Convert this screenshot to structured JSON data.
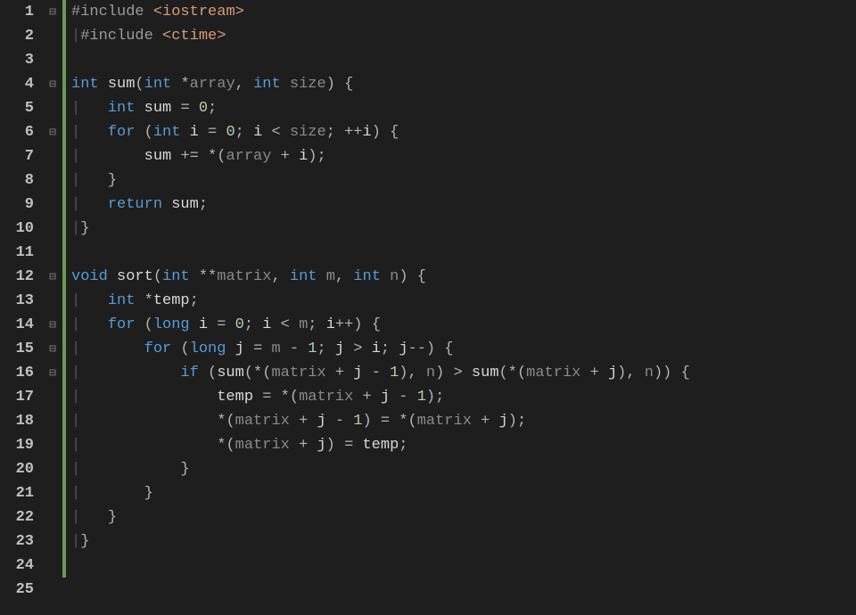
{
  "editor": {
    "line_count": 25,
    "fold_markers": {
      "1": "⊟",
      "4": "⊟",
      "6": "⊟",
      "12": "⊟",
      "14": "⊟",
      "15": "⊟",
      "16": "⊟"
    },
    "changed_lines": [
      1,
      2,
      3,
      4,
      5,
      6,
      7,
      8,
      9,
      10,
      11,
      12,
      13,
      14,
      15,
      16,
      17,
      18,
      19,
      20,
      21,
      22,
      23,
      24
    ],
    "code_lines": [
      {
        "n": 1,
        "tokens": [
          [
            "pp",
            "#include "
          ],
          [
            "inc",
            "<iostream>"
          ]
        ]
      },
      {
        "n": 2,
        "tokens": [
          [
            "vbar",
            "|"
          ],
          [
            "pp",
            "#include "
          ],
          [
            "inc",
            "<ctime>"
          ]
        ]
      },
      {
        "n": 3,
        "tokens": []
      },
      {
        "n": 4,
        "tokens": [
          [
            "kw",
            "int"
          ],
          [
            "id",
            " "
          ],
          [
            "fn",
            "sum"
          ],
          [
            "par",
            "("
          ],
          [
            "kw",
            "int"
          ],
          [
            "id",
            " "
          ],
          [
            "op",
            "*"
          ],
          [
            "g",
            "array"
          ],
          [
            "op",
            ", "
          ],
          [
            "kw",
            "int"
          ],
          [
            "id",
            " "
          ],
          [
            "g",
            "size"
          ],
          [
            "par",
            ") "
          ],
          [
            "par",
            "{"
          ]
        ]
      },
      {
        "n": 5,
        "tokens": [
          [
            "vbar",
            "|   "
          ],
          [
            "kw",
            "int"
          ],
          [
            "id",
            " sum "
          ],
          [
            "op",
            "= "
          ],
          [
            "num",
            "0"
          ],
          [
            "op",
            ";"
          ]
        ]
      },
      {
        "n": 6,
        "tokens": [
          [
            "vbar",
            "|   "
          ],
          [
            "kw",
            "for"
          ],
          [
            "id",
            " "
          ],
          [
            "par",
            "("
          ],
          [
            "kw",
            "int"
          ],
          [
            "id",
            " i "
          ],
          [
            "op",
            "= "
          ],
          [
            "num",
            "0"
          ],
          [
            "op",
            "; "
          ],
          [
            "id",
            "i "
          ],
          [
            "op",
            "< "
          ],
          [
            "g",
            "size"
          ],
          [
            "op",
            "; "
          ],
          [
            "op",
            "++"
          ],
          [
            "id",
            "i"
          ],
          [
            "par",
            ") "
          ],
          [
            "par",
            "{"
          ]
        ]
      },
      {
        "n": 7,
        "tokens": [
          [
            "vbar",
            "|       "
          ],
          [
            "id",
            "sum "
          ],
          [
            "op",
            "+= "
          ],
          [
            "op",
            "*"
          ],
          [
            "par",
            "("
          ],
          [
            "g",
            "array"
          ],
          [
            "id",
            " "
          ],
          [
            "op",
            "+ "
          ],
          [
            "id",
            "i"
          ],
          [
            "par",
            ")"
          ],
          [
            "op",
            ";"
          ]
        ]
      },
      {
        "n": 8,
        "tokens": [
          [
            "vbar",
            "|   "
          ],
          [
            "par",
            "}"
          ]
        ]
      },
      {
        "n": 9,
        "tokens": [
          [
            "vbar",
            "|   "
          ],
          [
            "kw",
            "return"
          ],
          [
            "id",
            " sum"
          ],
          [
            "op",
            ";"
          ]
        ]
      },
      {
        "n": 10,
        "tokens": [
          [
            "vbar",
            "|"
          ],
          [
            "par",
            "}"
          ]
        ]
      },
      {
        "n": 11,
        "tokens": []
      },
      {
        "n": 12,
        "tokens": [
          [
            "kw",
            "void"
          ],
          [
            "id",
            " "
          ],
          [
            "fn",
            "sort"
          ],
          [
            "par",
            "("
          ],
          [
            "kw",
            "int"
          ],
          [
            "id",
            " "
          ],
          [
            "op",
            "**"
          ],
          [
            "g",
            "matrix"
          ],
          [
            "op",
            ", "
          ],
          [
            "kw",
            "int"
          ],
          [
            "id",
            " "
          ],
          [
            "g",
            "m"
          ],
          [
            "op",
            ", "
          ],
          [
            "kw",
            "int"
          ],
          [
            "id",
            " "
          ],
          [
            "g",
            "n"
          ],
          [
            "par",
            ") "
          ],
          [
            "par",
            "{"
          ]
        ]
      },
      {
        "n": 13,
        "tokens": [
          [
            "vbar",
            "|   "
          ],
          [
            "kw",
            "int"
          ],
          [
            "id",
            " "
          ],
          [
            "op",
            "*"
          ],
          [
            "id",
            "temp"
          ],
          [
            "op",
            ";"
          ]
        ]
      },
      {
        "n": 14,
        "tokens": [
          [
            "vbar",
            "|   "
          ],
          [
            "kw",
            "for"
          ],
          [
            "id",
            " "
          ],
          [
            "par",
            "("
          ],
          [
            "kw",
            "long"
          ],
          [
            "id",
            " i "
          ],
          [
            "op",
            "= "
          ],
          [
            "num",
            "0"
          ],
          [
            "op",
            "; "
          ],
          [
            "id",
            "i "
          ],
          [
            "op",
            "< "
          ],
          [
            "g",
            "m"
          ],
          [
            "op",
            "; "
          ],
          [
            "id",
            "i"
          ],
          [
            "op",
            "++"
          ],
          [
            "par",
            ") "
          ],
          [
            "par",
            "{"
          ]
        ]
      },
      {
        "n": 15,
        "tokens": [
          [
            "vbar",
            "|       "
          ],
          [
            "kw",
            "for"
          ],
          [
            "id",
            " "
          ],
          [
            "par",
            "("
          ],
          [
            "kw",
            "long"
          ],
          [
            "id",
            " j "
          ],
          [
            "op",
            "= "
          ],
          [
            "g",
            "m"
          ],
          [
            "id",
            " "
          ],
          [
            "op",
            "- "
          ],
          [
            "num",
            "1"
          ],
          [
            "op",
            "; "
          ],
          [
            "id",
            "j "
          ],
          [
            "op",
            "> "
          ],
          [
            "id",
            "i"
          ],
          [
            "op",
            "; "
          ],
          [
            "id",
            "j"
          ],
          [
            "op",
            "--"
          ],
          [
            "par",
            ") "
          ],
          [
            "par",
            "{"
          ]
        ]
      },
      {
        "n": 16,
        "tokens": [
          [
            "vbar",
            "|           "
          ],
          [
            "kw",
            "if"
          ],
          [
            "id",
            " "
          ],
          [
            "par",
            "("
          ],
          [
            "fn",
            "sum"
          ],
          [
            "par",
            "("
          ],
          [
            "op",
            "*"
          ],
          [
            "par",
            "("
          ],
          [
            "g",
            "matrix"
          ],
          [
            "id",
            " "
          ],
          [
            "op",
            "+ "
          ],
          [
            "id",
            "j "
          ],
          [
            "op",
            "- "
          ],
          [
            "num",
            "1"
          ],
          [
            "par",
            ")"
          ],
          [
            "op",
            ", "
          ],
          [
            "g",
            "n"
          ],
          [
            "par",
            ") "
          ],
          [
            "op",
            "> "
          ],
          [
            "fn",
            "sum"
          ],
          [
            "par",
            "("
          ],
          [
            "op",
            "*"
          ],
          [
            "par",
            "("
          ],
          [
            "g",
            "matrix"
          ],
          [
            "id",
            " "
          ],
          [
            "op",
            "+ "
          ],
          [
            "id",
            "j"
          ],
          [
            "par",
            ")"
          ],
          [
            "op",
            ", "
          ],
          [
            "g",
            "n"
          ],
          [
            "par",
            "))"
          ],
          [
            "id",
            " "
          ],
          [
            "par",
            "{"
          ]
        ]
      },
      {
        "n": 17,
        "tokens": [
          [
            "vbar",
            "|               "
          ],
          [
            "id",
            "temp "
          ],
          [
            "op",
            "= "
          ],
          [
            "op",
            "*"
          ],
          [
            "par",
            "("
          ],
          [
            "g",
            "matrix"
          ],
          [
            "id",
            " "
          ],
          [
            "op",
            "+ "
          ],
          [
            "id",
            "j "
          ],
          [
            "op",
            "- "
          ],
          [
            "num",
            "1"
          ],
          [
            "par",
            ")"
          ],
          [
            "op",
            ";"
          ]
        ]
      },
      {
        "n": 18,
        "tokens": [
          [
            "vbar",
            "|               "
          ],
          [
            "op",
            "*"
          ],
          [
            "par",
            "("
          ],
          [
            "g",
            "matrix"
          ],
          [
            "id",
            " "
          ],
          [
            "op",
            "+ "
          ],
          [
            "id",
            "j "
          ],
          [
            "op",
            "- "
          ],
          [
            "num",
            "1"
          ],
          [
            "par",
            ") "
          ],
          [
            "op",
            "= "
          ],
          [
            "op",
            "*"
          ],
          [
            "par",
            "("
          ],
          [
            "g",
            "matrix"
          ],
          [
            "id",
            " "
          ],
          [
            "op",
            "+ "
          ],
          [
            "id",
            "j"
          ],
          [
            "par",
            ")"
          ],
          [
            "op",
            ";"
          ]
        ]
      },
      {
        "n": 19,
        "tokens": [
          [
            "vbar",
            "|               "
          ],
          [
            "op",
            "*"
          ],
          [
            "par",
            "("
          ],
          [
            "g",
            "matrix"
          ],
          [
            "id",
            " "
          ],
          [
            "op",
            "+ "
          ],
          [
            "id",
            "j"
          ],
          [
            "par",
            ") "
          ],
          [
            "op",
            "= "
          ],
          [
            "id",
            "temp"
          ],
          [
            "op",
            ";"
          ]
        ]
      },
      {
        "n": 20,
        "tokens": [
          [
            "vbar",
            "|           "
          ],
          [
            "par",
            "}"
          ]
        ]
      },
      {
        "n": 21,
        "tokens": [
          [
            "vbar",
            "|       "
          ],
          [
            "par",
            "}"
          ]
        ]
      },
      {
        "n": 22,
        "tokens": [
          [
            "vbar",
            "|   "
          ],
          [
            "par",
            "}"
          ]
        ]
      },
      {
        "n": 23,
        "tokens": [
          [
            "vbar",
            "|"
          ],
          [
            "par",
            "}"
          ]
        ]
      },
      {
        "n": 24,
        "tokens": []
      },
      {
        "n": 25,
        "tokens": []
      }
    ]
  }
}
